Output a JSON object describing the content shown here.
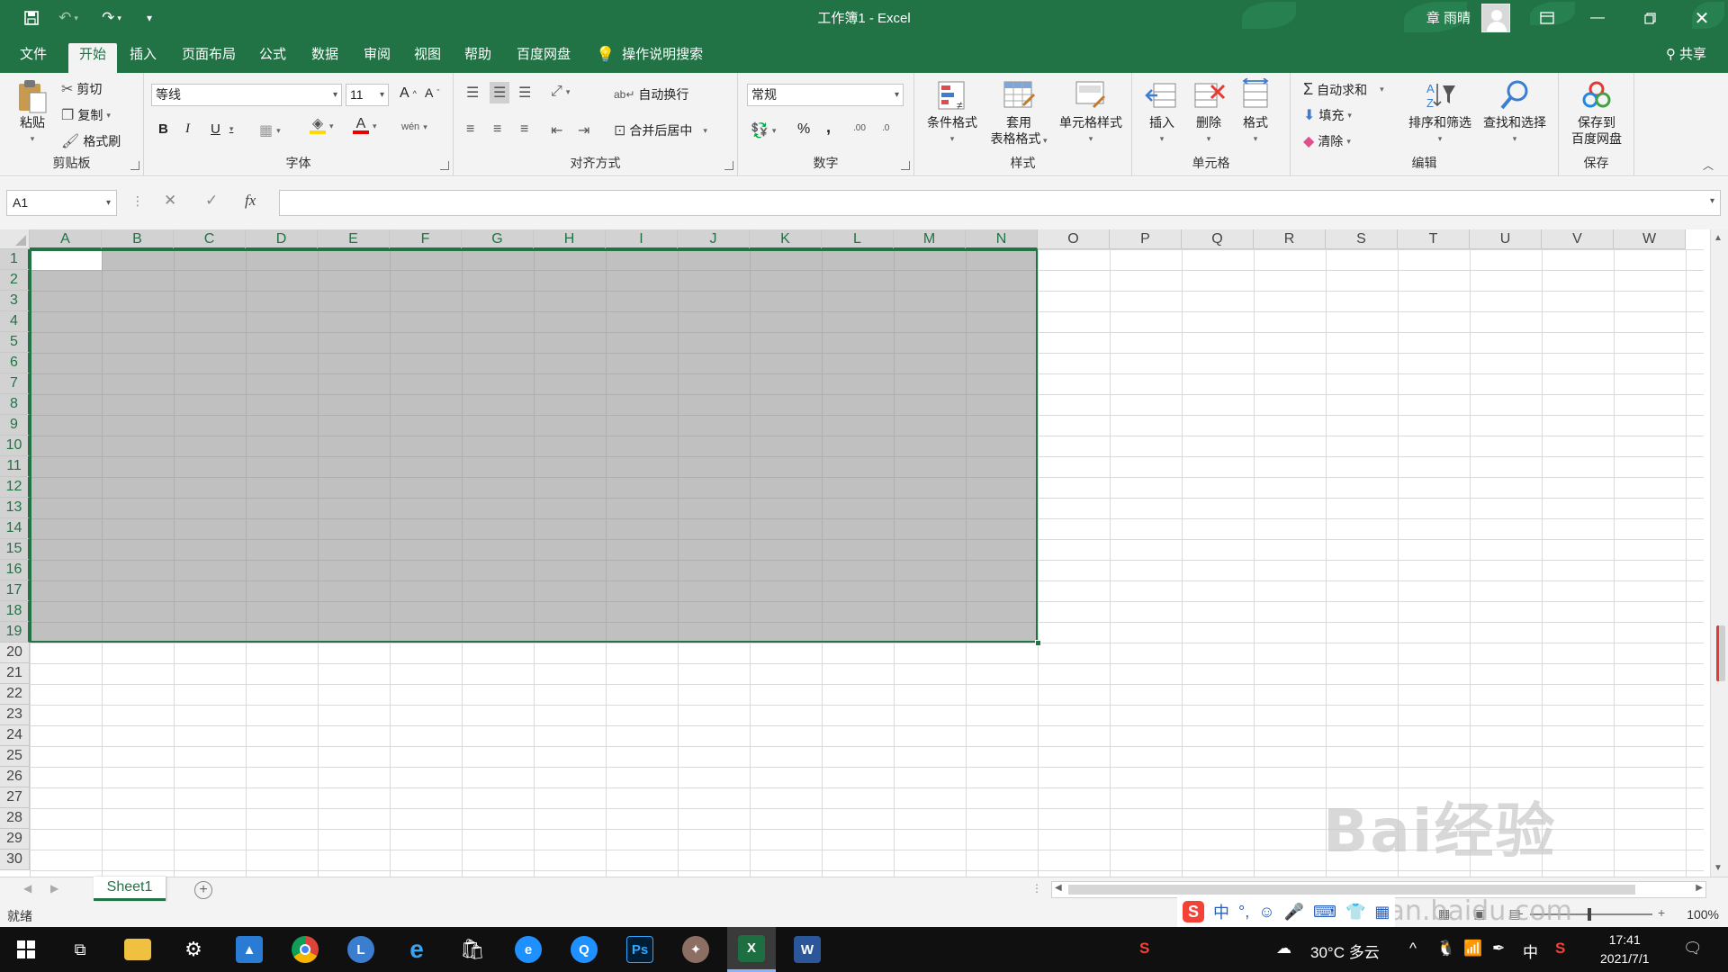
{
  "titlebar": {
    "title": "工作簿1  -  Excel",
    "user": "章 雨晴",
    "qa": [
      "save-icon",
      "undo-icon",
      "redo-icon",
      "customize-icon"
    ]
  },
  "tabs": {
    "items": [
      "文件",
      "开始",
      "插入",
      "页面布局",
      "公式",
      "数据",
      "审阅",
      "视图",
      "帮助",
      "百度网盘"
    ],
    "active": "开始",
    "search": "操作说明搜索",
    "share": "共享"
  },
  "ribbon": {
    "clipboard": {
      "label": "剪贴板",
      "paste": "粘贴",
      "cut": "剪切",
      "copy": "复制",
      "format_painter": "格式刷"
    },
    "font": {
      "label": "字体",
      "name": "等线",
      "size": "11",
      "bold": "B",
      "italic": "I",
      "underline": "U",
      "font_color_glyph": "A",
      "grow_glyph": "A",
      "shrink_glyph": "A",
      "phonetic_glyph": "wén"
    },
    "alignment": {
      "label": "对齐方式",
      "wrap": "自动换行",
      "merge": "合并后居中"
    },
    "number": {
      "label": "数字",
      "format": "常规",
      "percent": "%",
      "comma": ",",
      "inc_decimal": ".00",
      "dec_decimal": ".0"
    },
    "styles": {
      "label": "样式",
      "conditional": "条件格式",
      "table_line1": "套用",
      "table_line2": "表格格式",
      "cell_styles": "单元格样式"
    },
    "cells": {
      "label": "单元格",
      "insert": "插入",
      "delete": "删除",
      "format": "格式"
    },
    "editing": {
      "label": "编辑",
      "autosum": "自动求和",
      "fill": "填充",
      "clear": "清除",
      "sort": "排序和筛选",
      "find": "查找和选择"
    },
    "save": {
      "label": "保存",
      "line1": "保存到",
      "line2": "百度网盘"
    }
  },
  "formula_bar": {
    "name_box": "A1",
    "formula": "",
    "fx": "fx"
  },
  "grid": {
    "columns": [
      "A",
      "B",
      "C",
      "D",
      "E",
      "F",
      "G",
      "H",
      "I",
      "J",
      "K",
      "L",
      "M",
      "N",
      "O",
      "P",
      "Q",
      "R",
      "S",
      "T",
      "U",
      "V",
      "W"
    ],
    "rows": [
      "1",
      "2",
      "3",
      "4",
      "5",
      "6",
      "7",
      "8",
      "9",
      "10",
      "11",
      "12",
      "13",
      "14",
      "15",
      "16",
      "17",
      "18",
      "19",
      "20",
      "21",
      "22",
      "23",
      "24",
      "25",
      "26",
      "27",
      "28",
      "29",
      "30"
    ],
    "selection": "A1:N19",
    "selected_columns": [
      "A",
      "B",
      "C",
      "D",
      "E",
      "F",
      "G",
      "H",
      "I",
      "J",
      "K",
      "L",
      "M",
      "N"
    ],
    "selected_row_count": 19
  },
  "sheets": {
    "tabs": [
      "Sheet1"
    ],
    "add_label": "+"
  },
  "status": {
    "ready": "就绪",
    "zoom": "100%",
    "zoom_minus": "-",
    "zoom_plus": "+"
  },
  "ime": {
    "logo": "S",
    "mode": "中",
    "punct": "°,"
  },
  "watermark": {
    "main": "Bai经验",
    "sub": "jingyan.baidu.com"
  },
  "taskbar": {
    "weather": "30°C  多云",
    "ime": "中",
    "time": "17:41",
    "date": "2021/7/1",
    "ps_label": "Ps",
    "excel_label": "X",
    "word_label": "W"
  },
  "colors": {
    "accent": "#217346",
    "selection_fill": "#c0c0c0",
    "taskbar": "#101010"
  }
}
